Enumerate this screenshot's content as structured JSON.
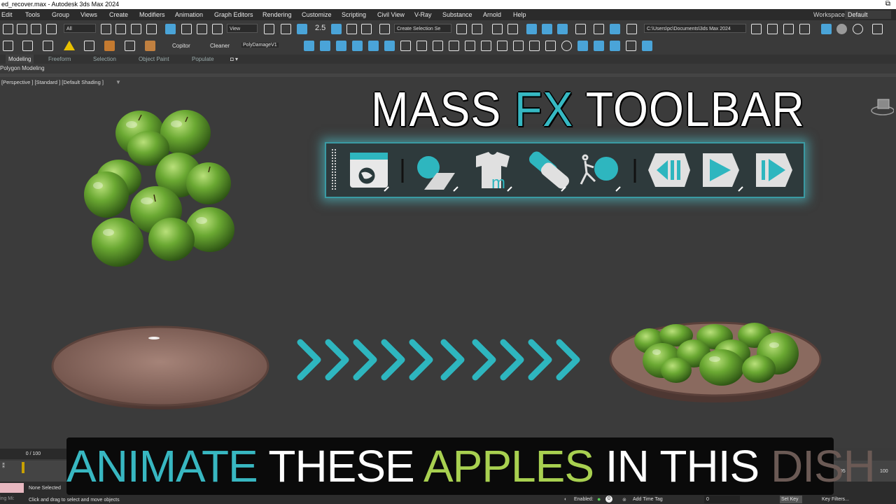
{
  "window": {
    "title": "ed_recover.max - Autodesk 3ds Max 2024",
    "restore_glyph": "⧉"
  },
  "menu": [
    "Edit",
    "Tools",
    "Group",
    "Views",
    "Create",
    "Modifiers",
    "Animation",
    "Graph Editors",
    "Rendering",
    "Customize",
    "Scripting",
    "Civil View",
    "V-Ray",
    "Substance",
    "Arnold",
    "Help"
  ],
  "workspaces": {
    "label": "Workspaces:",
    "value": "Default"
  },
  "toolbar": {
    "filter_value": "All",
    "refcoord_value": "View",
    "snap_count": "2.5",
    "selection_set_placeholder": "Create Selection Se",
    "project_path": "C:\\Users\\pc\\Documents\\3ds Max 2024",
    "copitor_label": "Copitor",
    "cleaner_label": "Cleaner",
    "polydamage_label": "PolyDamageV1"
  },
  "ribbon": {
    "tabs": [
      "Modeling",
      "Freeform",
      "Selection",
      "Object Paint",
      "Populate"
    ],
    "active": "Modeling",
    "subpanel": "Polygon Modeling"
  },
  "viewport": {
    "label": "[Perspective ] [Standard ] [Default Shading ]"
  },
  "overlay": {
    "title_part1": "MASS ",
    "title_fx": "FX",
    "title_part2": " TOOLBAR",
    "bottom_words": [
      "ANIMATE",
      "THESE",
      "APPLES",
      "IN THIS",
      "DISH"
    ],
    "colors": {
      "teal": "#38b7c1",
      "green": "#a8d050",
      "brown": "#6b5a55"
    }
  },
  "massfx_icons": [
    "world-settings-icon",
    "rigid-body-icon",
    "mcloth-icon",
    "constraint-icon",
    "ragdoll-icon",
    "reset-simulation-icon",
    "start-simulation-icon",
    "step-simulation-icon"
  ],
  "timeline": {
    "frame": "0 / 100",
    "ticks": [
      "95",
      "100"
    ]
  },
  "status": {
    "selection": "None Selected",
    "prompt": "Click and drag to select and move objects",
    "enabled_label": "Enabled:",
    "enabled_value": "0",
    "add_time_tag": "Add Time Tag",
    "spinner_value": "0",
    "set_key": "Set Key",
    "key_filters": "Key Filters...",
    "maxscript_hint": "ing Mi:"
  }
}
